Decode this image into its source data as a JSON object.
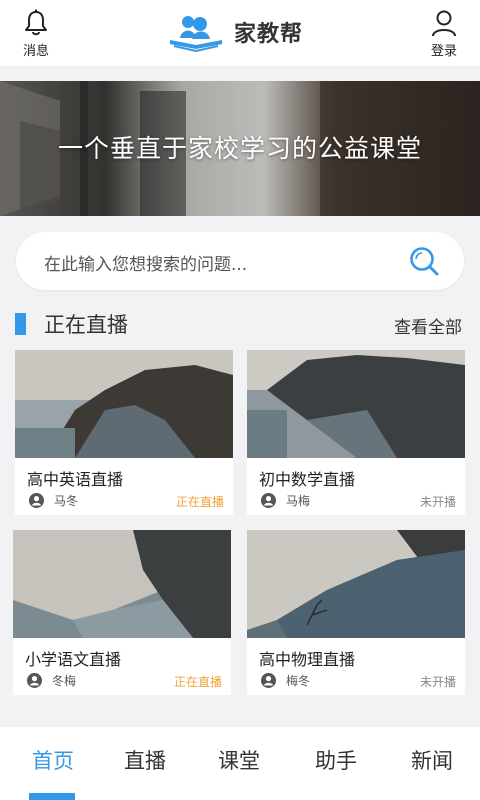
{
  "header": {
    "messages_label": "消息",
    "app_name": "家教帮",
    "login_label": "登录",
    "accent": "#3498e8"
  },
  "banner": {
    "slogan": "一个垂直于家校学习的公益课堂"
  },
  "search": {
    "placeholder": "在此输入您想搜索的问题..."
  },
  "section": {
    "title": "正在直播",
    "see_all": "查看全部"
  },
  "courses": [
    {
      "title": "高中英语直播",
      "teacher": "马冬",
      "status": "正在直播",
      "live": true
    },
    {
      "title": "初中数学直播",
      "teacher": "马梅",
      "status": "未开播",
      "live": false
    },
    {
      "title": "小学语文直播",
      "teacher": "冬梅",
      "status": "正在直播",
      "live": true
    },
    {
      "title": "高中物理直播",
      "teacher": "梅冬",
      "status": "未开播",
      "live": false
    }
  ],
  "nav": {
    "tabs": [
      "首页",
      "直播",
      "课堂",
      "助手",
      "新闻"
    ],
    "active": "首页"
  },
  "colors": {
    "live": "#f0a23a",
    "inactive": "#888888",
    "accent": "#3498e8"
  }
}
